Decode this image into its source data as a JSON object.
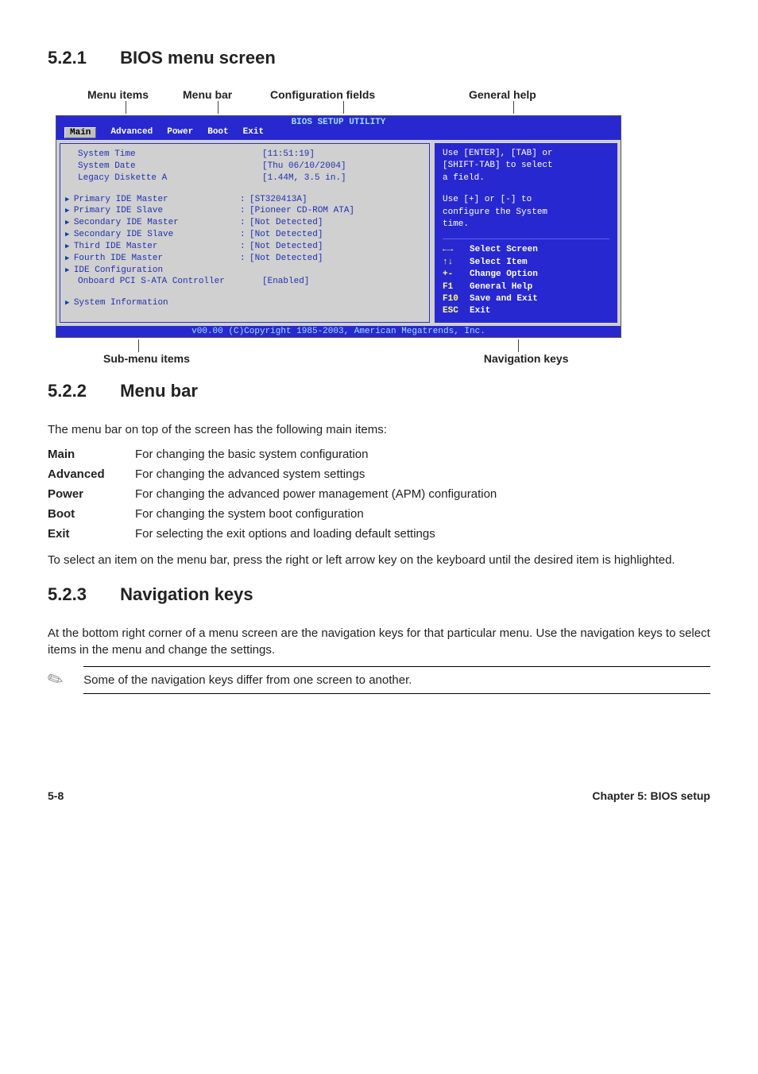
{
  "section1": {
    "num": "5.2.1",
    "title": "BIOS menu screen"
  },
  "diagram_labels": {
    "top": [
      "Menu items",
      "Menu bar",
      "Configuration fields",
      "General help"
    ],
    "bottom_left": "Sub-menu items",
    "bottom_right": "Navigation keys"
  },
  "bios": {
    "title": "BIOS SETUP UTILITY",
    "menubar": [
      "Main",
      "Advanced",
      "Power",
      "Boot",
      "Exit"
    ],
    "rows": [
      {
        "type": "plain",
        "label": "System Time",
        "sep": "",
        "val": "[11:51:19]"
      },
      {
        "type": "plain",
        "label": "System Date",
        "sep": "",
        "val": "[Thu 06/10/2004]"
      },
      {
        "type": "plain",
        "label": "Legacy Diskette A",
        "sep": "",
        "val": "[1.44M, 3.5 in.]"
      },
      {
        "type": "spacer"
      },
      {
        "type": "arrow",
        "label": "Primary IDE Master",
        "sep": ":",
        "val": "[ST320413A]"
      },
      {
        "type": "arrow",
        "label": "Primary IDE Slave",
        "sep": ":",
        "val": "[Pioneer CD-ROM ATA]"
      },
      {
        "type": "arrow",
        "label": "Secondary IDE Master",
        "sep": ":",
        "val": "[Not Detected]"
      },
      {
        "type": "arrow",
        "label": "Secondary IDE Slave",
        "sep": ":",
        "val": "[Not Detected]"
      },
      {
        "type": "arrow",
        "label": "Third IDE Master",
        "sep": ":",
        "val": "[Not Detected]"
      },
      {
        "type": "arrow",
        "label": "Fourth IDE Master",
        "sep": ":",
        "val": "[Not Detected]"
      },
      {
        "type": "arrow",
        "label": "IDE Configuration",
        "sep": "",
        "val": ""
      },
      {
        "type": "plain",
        "label": "Onboard PCI S-ATA Controller",
        "sep": "",
        "val": "[Enabled]"
      },
      {
        "type": "spacer"
      },
      {
        "type": "arrow",
        "label": "System Information",
        "sep": "",
        "val": ""
      }
    ],
    "help": {
      "line1": "Use [ENTER], [TAB] or",
      "line2": "[SHIFT-TAB] to select",
      "line3": "a field.",
      "line4": "Use [+] or [-] to",
      "line5": "configure the System",
      "line6": "time."
    },
    "navkeys": [
      {
        "k": "←→",
        "t": "Select Screen"
      },
      {
        "k": "↑↓",
        "t": "Select Item"
      },
      {
        "k": "+-",
        "t": "Change Option"
      },
      {
        "k": "F1",
        "t": "General Help"
      },
      {
        "k": "F10",
        "t": "Save and Exit"
      },
      {
        "k": "ESC",
        "t": "Exit"
      }
    ],
    "copyright": "v00.00 (C)Copyright 1985-2003, American Megatrends, Inc."
  },
  "section2": {
    "num": "5.2.2",
    "title": "Menu bar"
  },
  "section2_intro": "The menu bar on top of the screen has the following main items:",
  "menu_table": [
    {
      "label": "Main",
      "desc": "For changing the basic system configuration"
    },
    {
      "label": "Advanced",
      "desc": "For changing the advanced system settings"
    },
    {
      "label": "Power",
      "desc": "For changing the advanced power management (APM) configuration"
    },
    {
      "label": "Boot",
      "desc": "For changing the system boot configuration"
    },
    {
      "label": "Exit",
      "desc": "For selecting the exit options and loading default settings"
    }
  ],
  "section2_outro": "To select an item on the menu bar, press the right or left arrow key on the keyboard until the desired item is highlighted.",
  "section3": {
    "num": "5.2.3",
    "title": "Navigation keys"
  },
  "section3_body": "At the bottom right corner of a menu screen are the navigation keys for that particular menu. Use the navigation keys to select items in the menu and change the settings.",
  "note": "Some of the navigation keys differ from one screen to another.",
  "footer": {
    "page": "5-8",
    "chapter": "Chapter 5: BIOS setup"
  }
}
